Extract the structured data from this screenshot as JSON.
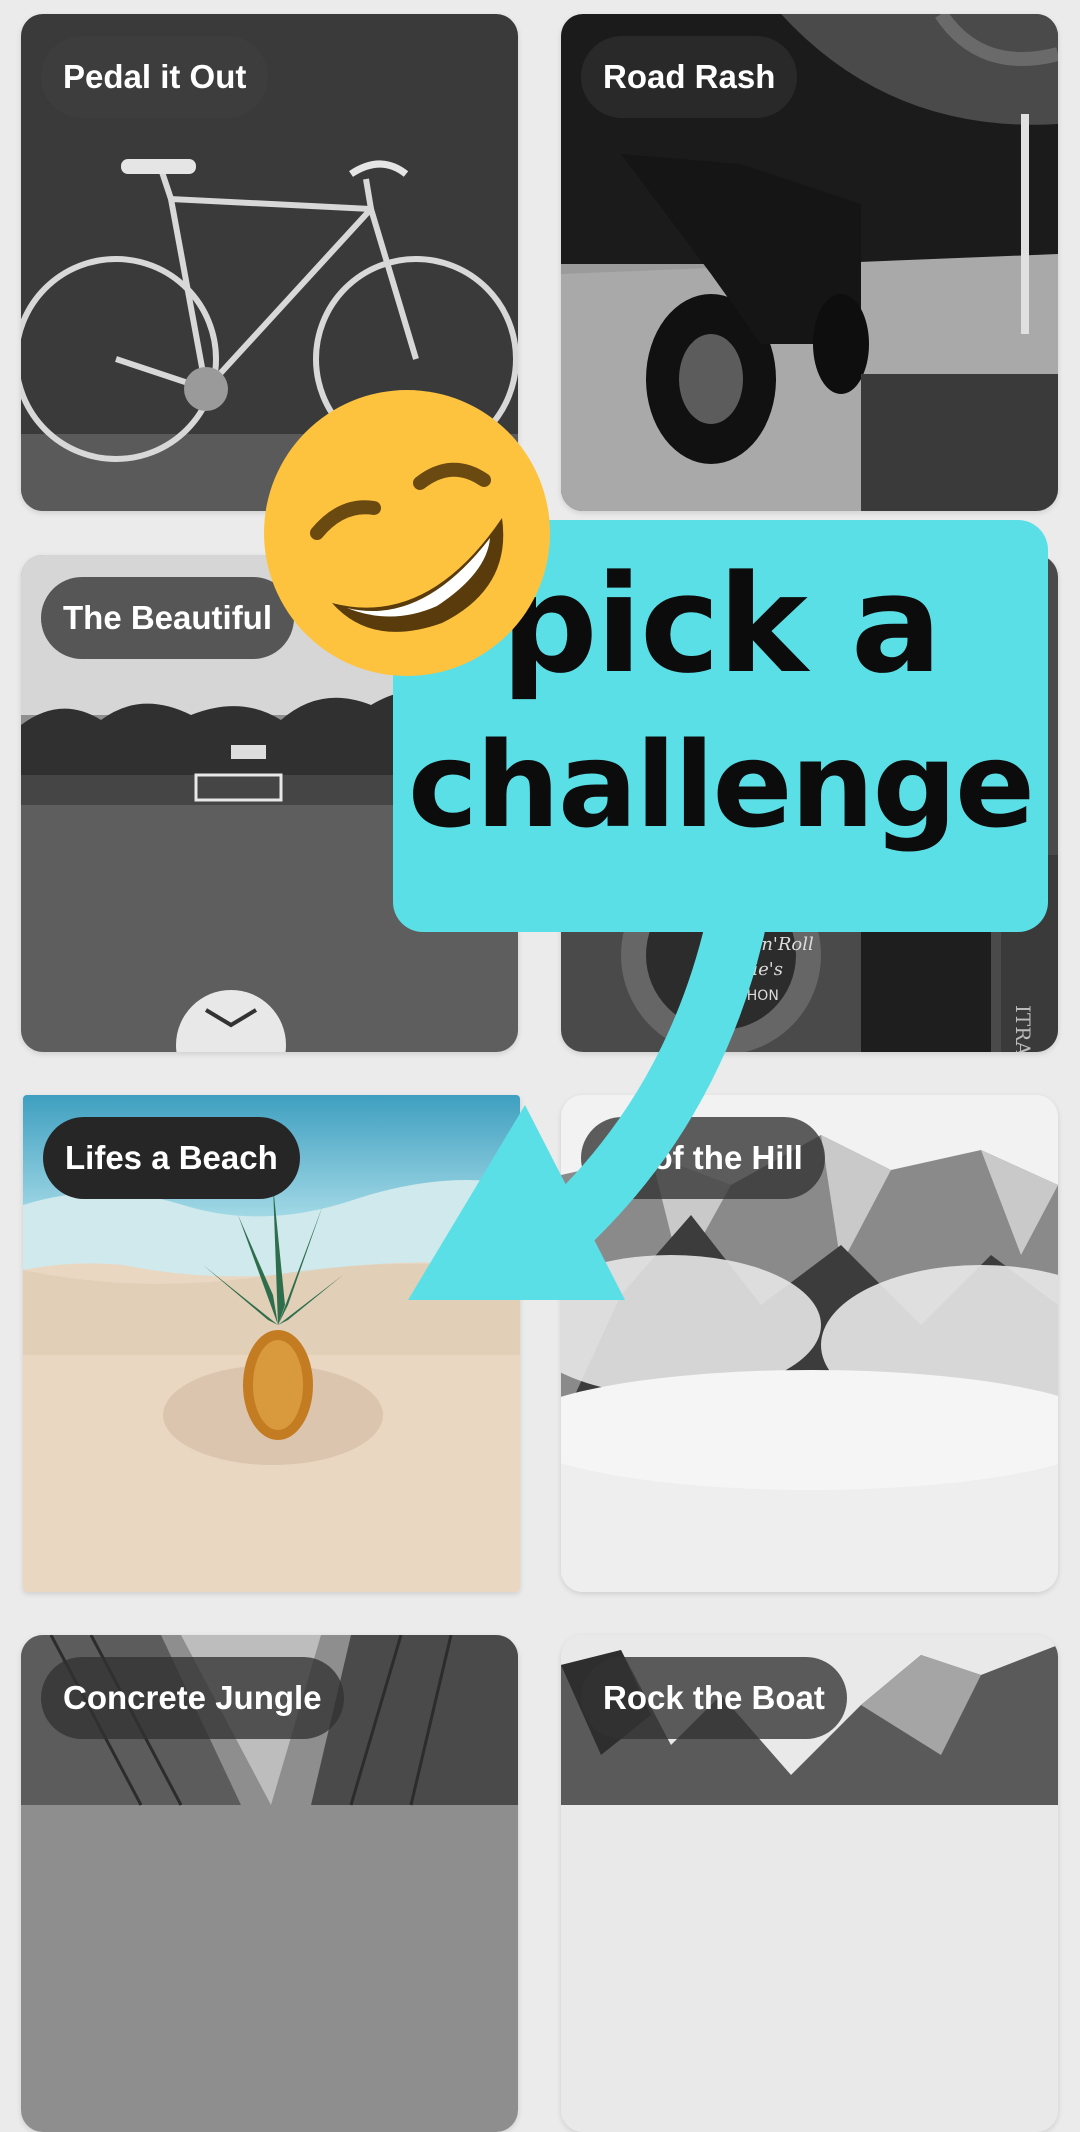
{
  "challenges": [
    {
      "title": "Pedal it Out",
      "photo": "bicycle-photo"
    },
    {
      "title": "Road Rash",
      "photo": "motorcycle-photo"
    },
    {
      "title": "The Beautiful",
      "photo": "soccer-field-photo"
    },
    {
      "title": "",
      "photo": "marathon-medal-photo"
    },
    {
      "title": "Lifes a Beach",
      "photo": "pineapple-beach-photo"
    },
    {
      "title": "ng of the Hill",
      "photo": "misty-mountain-photo"
    },
    {
      "title": "Concrete Jungle",
      "photo": "skyscrapers-photo"
    },
    {
      "title": "Rock the Boat",
      "photo": "mountain-lake-photo"
    }
  ],
  "medal_text": {
    "line1": "Rock'n'Roll",
    "line2": "Lorie's",
    "line3": "ARATHON",
    "strap": "ITRA"
  },
  "callout": {
    "line1": "pick a",
    "line2": "challenge",
    "color": "#5bdfe6"
  },
  "emoji": "grinning-squinting-face",
  "colors": {
    "background": "#ebebeb",
    "pill": "#323232"
  }
}
